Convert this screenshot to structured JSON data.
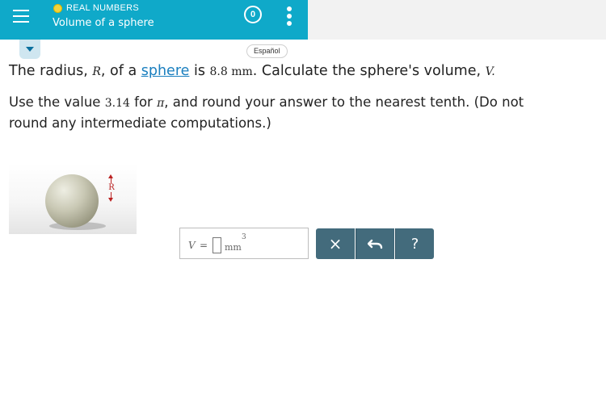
{
  "header": {
    "topic": "REAL NUMBERS",
    "title": "Volume of a sphere",
    "progress_count": "0",
    "topic_dot_color": "#f3d33b",
    "bg_color": "#0fa9c9"
  },
  "language_button": "Español",
  "problem": {
    "line1_part1": "The radius, ",
    "radius_var": "R",
    "line1_part2": ", of a ",
    "link_text": "sphere",
    "line1_part3": " is ",
    "radius_value": "8.8",
    "radius_unit": "mm",
    "line1_part4": ". Calculate the sphere's volume, ",
    "volume_var": "V",
    "line1_part5": ".",
    "line2_part1": "Use the value ",
    "pi_value": "3.14",
    "line2_part2": " for ",
    "pi_symbol": "π",
    "line2_part3": ", and round your answer to the nearest tenth. (Do not",
    "line3": "round any intermediate computations.)"
  },
  "figure": {
    "radius_label": "R"
  },
  "answer": {
    "var": "V",
    "equals": "=",
    "value": "",
    "unit": "mm",
    "exponent": "3"
  },
  "buttons": {
    "clear": "×",
    "help": "?"
  },
  "icons": {
    "menu": "hamburger-menu-icon",
    "more": "vertical-dots-icon",
    "undo": "undo-icon"
  }
}
